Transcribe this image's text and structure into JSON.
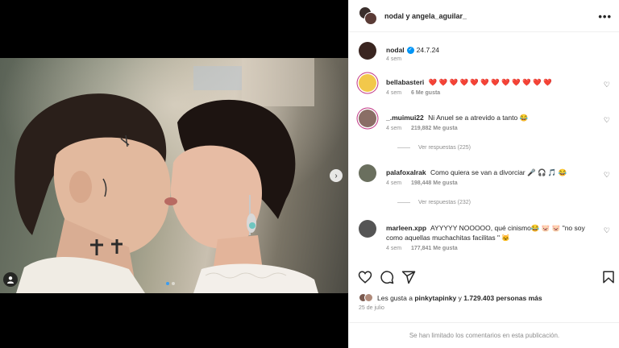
{
  "post": {
    "header_title": "nodal y angela_aguilar_",
    "more_icon": "more-options-icon"
  },
  "caption": {
    "username": "nodal",
    "text": "24.7.24",
    "time": "4 sem"
  },
  "comments": [
    {
      "username": "bellabasteri",
      "text": "❤️ ❤️ ❤️ ❤️ ❤️ ❤️ ❤️ ❤️ ❤️ ❤️ ❤️ ❤️",
      "time": "4 sem",
      "likes": "6 Me gusta"
    },
    {
      "username": "_.muimui22",
      "text": "Ni Anuel se a atrevido a tanto 😂",
      "time": "4 sem",
      "likes": "219,882 Me gusta",
      "replies": "Ver respuestas (225)"
    },
    {
      "username": "palafoxalrak",
      "text": "Como quiera se van a divorciar 🎤 🎧 🎵 😂",
      "time": "4 sem",
      "likes": "198,448 Me gusta",
      "replies": "Ver respuestas (232)"
    },
    {
      "username": "marleen.xpp",
      "text": "AYYYYY NOOOOO, qué cinismo😂 🐷 🐷 \"no soy como aquellas muchachitas facilitas \" 🐱",
      "time": "4 sem",
      "likes": "177,841 Me gusta"
    }
  ],
  "likes_summary": {
    "prefix": "Les gusta a",
    "user": "pinkytapinky",
    "connector": "y",
    "others": "1.729.403 personas más"
  },
  "date": "25 de julio",
  "comments_limited": "Se han limitado los comentarios en esta publicación."
}
